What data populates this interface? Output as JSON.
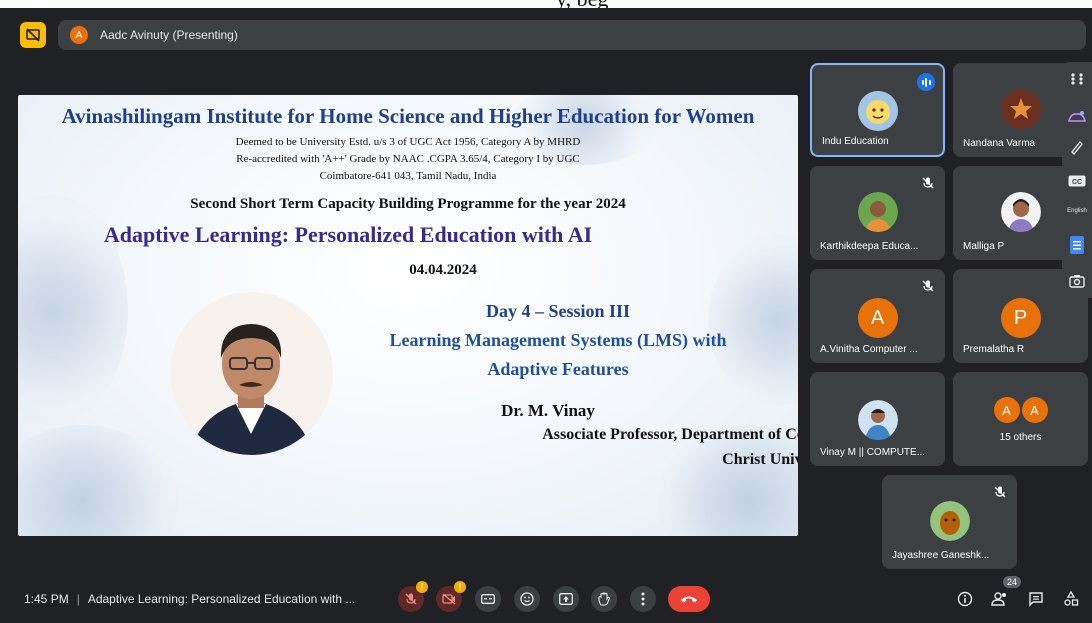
{
  "caption_top": "y, beg",
  "presenter": {
    "avatar_letter": "A",
    "label": "Aadc Avinuty (Presenting)"
  },
  "slide": {
    "institution": "Avinashilingam Institute for Home Science and Higher Education for Women",
    "line1": "Deemed to be University Estd. u/s 3 of UGC Act 1956, Category A by MHRD",
    "line2": "Re-accredited with 'A++' Grade by NAAC  .CGPA 3.65/4, Category I by UGC",
    "line3": "Coimbatore-641 043, Tamil Nadu, India",
    "programme": "Second Short Term Capacity Building Programme for the year 2024",
    "title": "Adaptive Learning: Personalized Education with AI",
    "date": "04.04.2024",
    "session": "Day 4 – Session III",
    "topic_line1": "Learning Management Systems (LMS) with",
    "topic_line2": "Adaptive Features",
    "speaker": "Dr. M. Vinay",
    "designation": "Associate Professor, Department of Computer Science,",
    "affiliation": "Christ University, Bangalore."
  },
  "participants": [
    {
      "name": "Indu Education",
      "speaking": true
    },
    {
      "name": "Nandana Varma"
    },
    {
      "name": "Karthikdeepa Educa...",
      "muted": true
    },
    {
      "name": "Malliga P"
    },
    {
      "name": "A.Vinitha Computer ...",
      "letter": "A",
      "muted": true
    },
    {
      "name": "Premalatha R",
      "letter": "P"
    },
    {
      "name": "Vinay M || COMPUTE...",
      "muted": true
    },
    {
      "others_letters": [
        "A",
        "A"
      ],
      "others_label": "15 others"
    },
    {
      "name": "Jayashree Ganeshk...",
      "muted": true
    }
  ],
  "side_panel": {
    "caption_language": "English"
  },
  "bottom": {
    "time": "1:45 PM",
    "separator": "|",
    "meeting_title": "Adaptive Learning: Personalized Education with ...",
    "warn_mark": "!",
    "participant_count": "24"
  },
  "colors": {
    "accent": "#8ab4f8",
    "leave": "#ea4335",
    "warning": "#f9ab00",
    "avatar_orange": "#e8710a",
    "present_yellow": "#fbbc04"
  }
}
